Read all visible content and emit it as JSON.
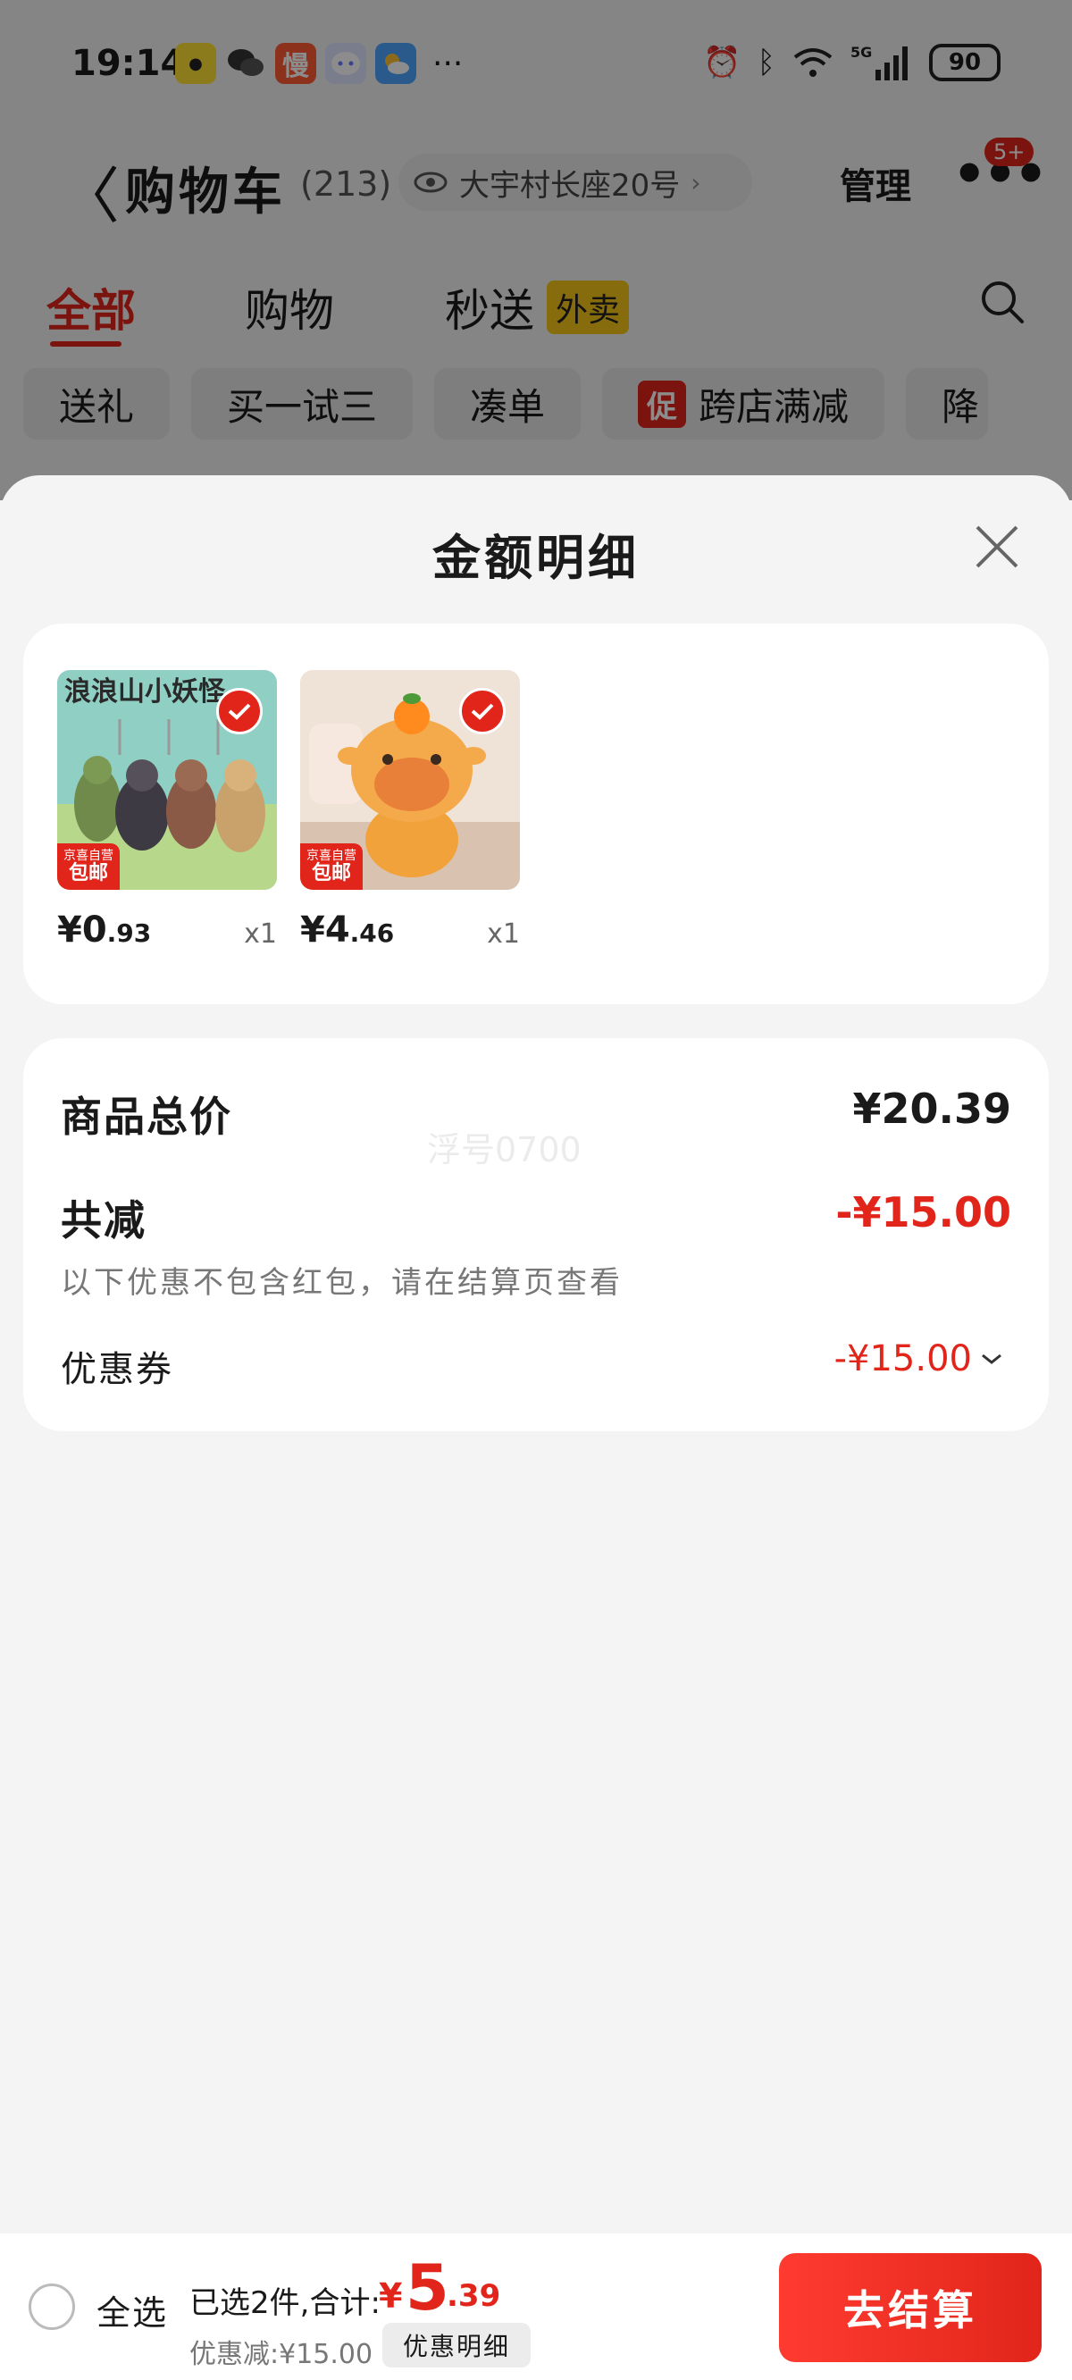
{
  "status_bar": {
    "time": "19:14",
    "more": "···",
    "battery": "90",
    "network": "5G"
  },
  "cart_page": {
    "title": "购物车",
    "count": "(213)",
    "address": "大宇村长座20号",
    "manage": "管理",
    "badge": "5+",
    "tabs": [
      {
        "label": "全部"
      },
      {
        "label": "购物"
      },
      {
        "label": "秒送"
      }
    ],
    "waimai_tag": "外卖",
    "chips": [
      "送礼",
      "买一试三",
      "凑单",
      "跨店满减",
      "降"
    ],
    "promo_tag": "促"
  },
  "sheet": {
    "title": "金额明细",
    "products": [
      {
        "price_int": "¥0",
        "price_dec": ".93",
        "qty": "x1",
        "tag_top": "京喜自营",
        "tag_bottom": "包邮",
        "art_text": "浪浪山小妖怪"
      },
      {
        "price_int": "¥4",
        "price_dec": ".46",
        "qty": "x1",
        "tag_top": "京喜自营",
        "tag_bottom": "包邮"
      }
    ],
    "summary": {
      "total_label": "商品总价",
      "total_value": "¥20.39",
      "reduce_label": "共减",
      "reduce_value": "-¥15.00",
      "note": "以下优惠不包含红包，请在结算页查看",
      "coupon_label": "优惠券",
      "coupon_value": "-¥15.00",
      "watermark": "浮号0700"
    }
  },
  "bottom_bar": {
    "select_all": "全选",
    "selected_text": "已选2件,合计:",
    "currency": "¥",
    "total_int": "5",
    "total_dec": ".39",
    "discount_text": "优惠减:¥15.00",
    "detail_button": "优惠明细",
    "checkout_button": "去结算"
  },
  "colors": {
    "accent": "#e1251b",
    "waimai": "#f5c518"
  }
}
